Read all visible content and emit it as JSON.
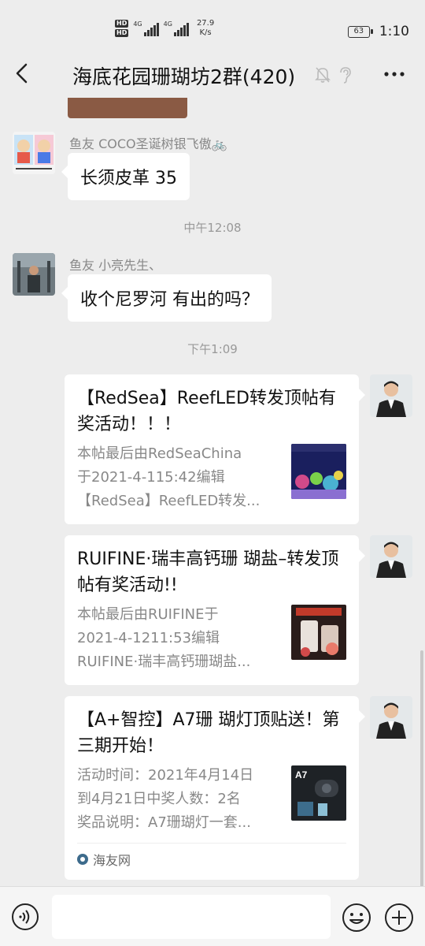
{
  "status_bar": {
    "hd1": "HD",
    "hd2": "HD",
    "net1": "4G",
    "net2": "4G",
    "speed_value": "27.9",
    "speed_unit": "K/s",
    "battery": "63",
    "time": "1:10"
  },
  "nav": {
    "title": "海底花园珊瑚坊2群(420)"
  },
  "messages": [
    {
      "sender": "鱼友 COCO圣诞树银飞傲🚲",
      "text": "长须皮革 35"
    },
    {
      "timestamp": "中午12:08"
    },
    {
      "sender": "鱼友 小亮先生、",
      "text": "收个尼罗河 有出的吗？"
    },
    {
      "timestamp": "下午1:09"
    }
  ],
  "cards": [
    {
      "title": "【RedSea】ReefLED转发顶帖有奖活动！！！",
      "desc": [
        "本帖最后由RedSeaChina",
        "于2021-4-115:42编辑",
        "【RedSea】ReefLED转发..."
      ]
    },
    {
      "title": "RUIFINE·瑞丰高钙珊 瑚盐–转发顶帖有奖活动!!",
      "desc": [
        "本帖最后由RUIFINE于",
        "2021-4-1211:53编辑",
        "RUIFINE·瑞丰高钙珊瑚盐..."
      ]
    },
    {
      "title": "【A+智控】A7珊 瑚灯顶贴送！第三期开始！",
      "desc": [
        "活动时间：2021年4月14日",
        "到4月21日中奖人数：2名",
        "奖品说明：A7珊瑚灯一套..."
      ],
      "thumb_label": "A7",
      "source": "海友网"
    }
  ],
  "colors": {
    "background": "#ededed",
    "bubble": "#ffffff",
    "muted_text": "#888888"
  }
}
